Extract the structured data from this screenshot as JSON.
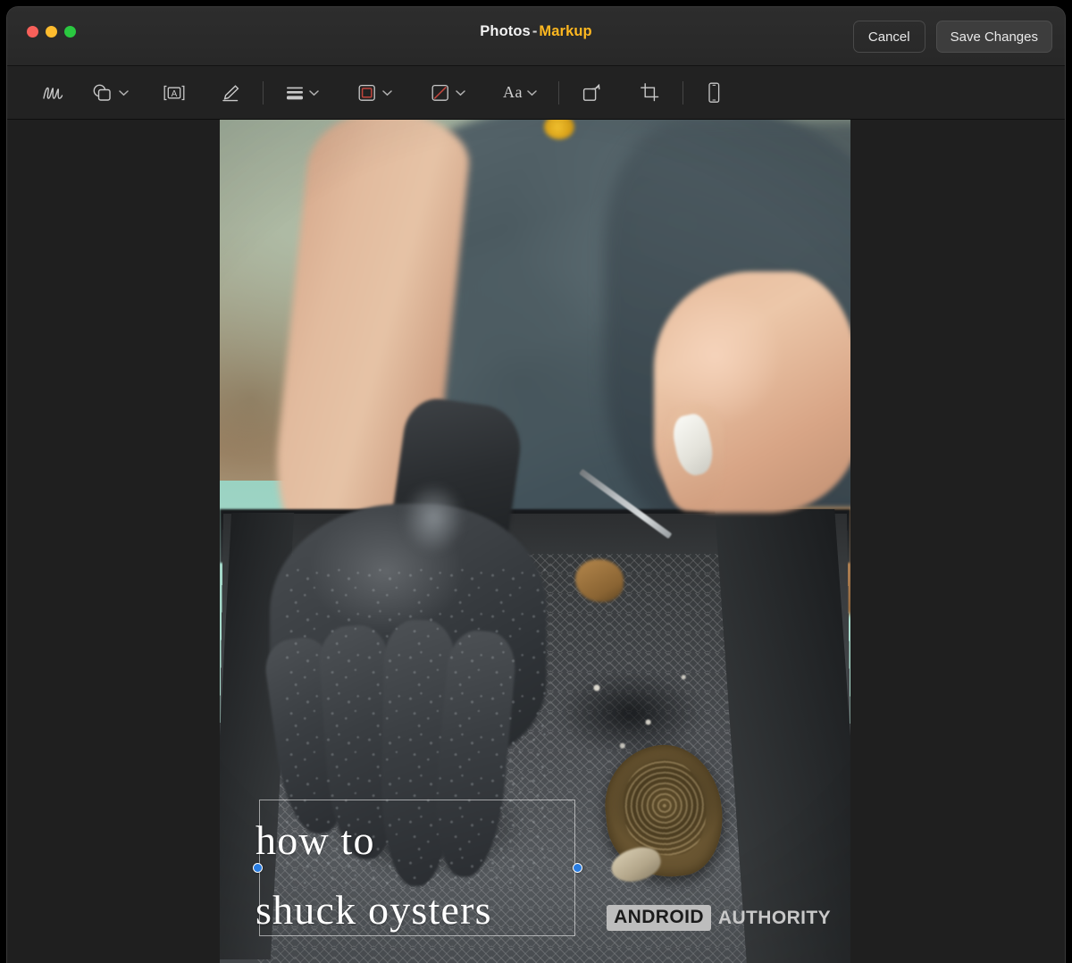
{
  "window": {
    "app_name": "Photos",
    "separator": "-",
    "mode": "Markup",
    "traffic_lights": [
      {
        "name": "close",
        "color": "#f8605a"
      },
      {
        "name": "minimize",
        "color": "#febc2e"
      },
      {
        "name": "zoom",
        "color": "#2ac840"
      }
    ]
  },
  "titlebar_actions": {
    "cancel_label": "Cancel",
    "save_label": "Save Changes"
  },
  "toolbar": {
    "items": [
      {
        "id": "sketch",
        "icon": "sketch-squiggle-icon",
        "label": "Sketch",
        "has_menu": false
      },
      {
        "id": "shapes",
        "icon": "shapes-icon",
        "label": "Shapes",
        "has_menu": true
      },
      {
        "id": "text",
        "icon": "text-box-icon",
        "label": "Text",
        "has_menu": false
      },
      {
        "id": "sign",
        "icon": "signature-pen-icon",
        "label": "Sign",
        "has_menu": false
      },
      {
        "id": "shape-style",
        "icon": "line-weight-icon",
        "label": "Shape Style",
        "has_menu": true
      },
      {
        "id": "border-color",
        "icon": "border-color-icon",
        "label": "Border Color",
        "has_menu": true
      },
      {
        "id": "fill-color",
        "icon": "fill-none-icon",
        "label": "Fill Color",
        "has_menu": true
      },
      {
        "id": "text-style",
        "icon": "text-style-icon",
        "label": "Aa",
        "has_menu": true
      },
      {
        "id": "rotate",
        "icon": "rotate-icon",
        "label": "Rotate",
        "has_menu": false
      },
      {
        "id": "crop",
        "icon": "crop-icon",
        "label": "Crop",
        "has_menu": false
      },
      {
        "id": "device-annotate",
        "icon": "iphone-device-icon",
        "label": "Annotate from Device",
        "has_menu": false
      }
    ],
    "text_style_label": "Aa",
    "accent_color": "#ffb820",
    "markup_red": "#c0453c"
  },
  "canvas": {
    "photo_alt": "Person in slate t-shirt shucking an oyster with a black rubber glove over a dark tray on a mint counter",
    "markup_text": "how to\nshuck oysters",
    "selection_handle_color": "#2a7de1",
    "text_color": "#ffffff"
  },
  "watermark": {
    "box_text": "ANDROID",
    "plain_text": "AUTHORITY"
  }
}
